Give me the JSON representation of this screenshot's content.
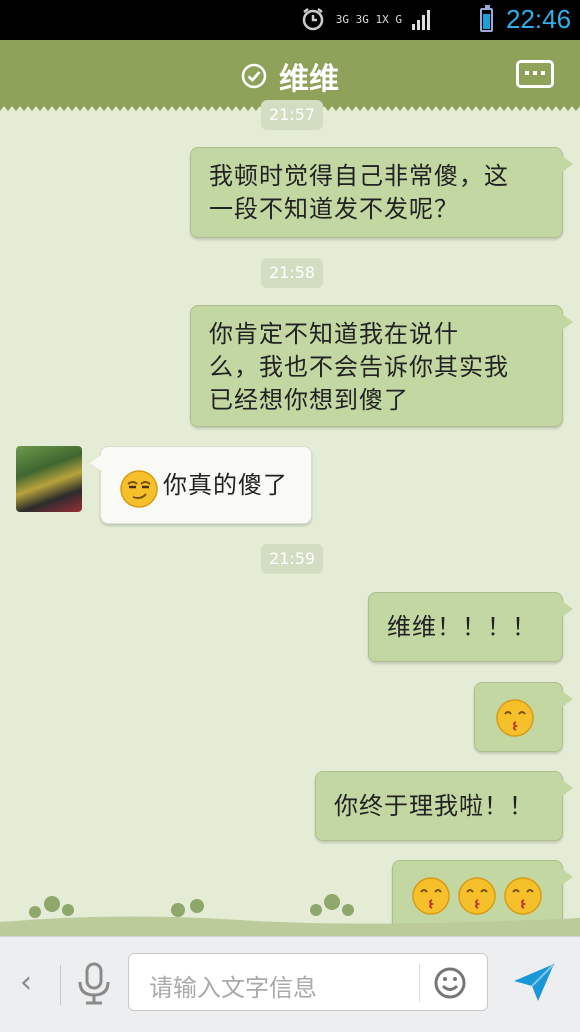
{
  "status_bar": {
    "time": "22:46",
    "network": "3G 3G 1X G"
  },
  "header": {
    "title": "维维"
  },
  "messages": {
    "t1": "21:57",
    "m1_line1": "我顿时觉得自己非常傻，这",
    "m1_line2": "一段不知道发不发呢？",
    "t2": "21:58",
    "m2_line1": "你肯定不知道我在说什",
    "m2_line2": "么，我也不会告诉你其实我",
    "m2_line3": "已经想你想到傻了",
    "m3_text": "你真的傻了",
    "t3": "21:59",
    "m4_text": "维维！！！！",
    "m6_text": "你终于理我啦！！"
  },
  "input": {
    "placeholder": "请输入文字信息"
  },
  "icons": {
    "check": "check-circle-icon",
    "more": "more-icon",
    "back": "chevron-left-icon",
    "mic": "microphone-icon",
    "smile": "smiley-icon",
    "send": "send-icon"
  },
  "colors": {
    "title_bar": "#8fa25a",
    "chat_background": "#e4ecd6",
    "outgoing_bubble": "#c3d7a2",
    "incoming_bubble": "#f9faf6",
    "clock": "#2fb0ea"
  }
}
